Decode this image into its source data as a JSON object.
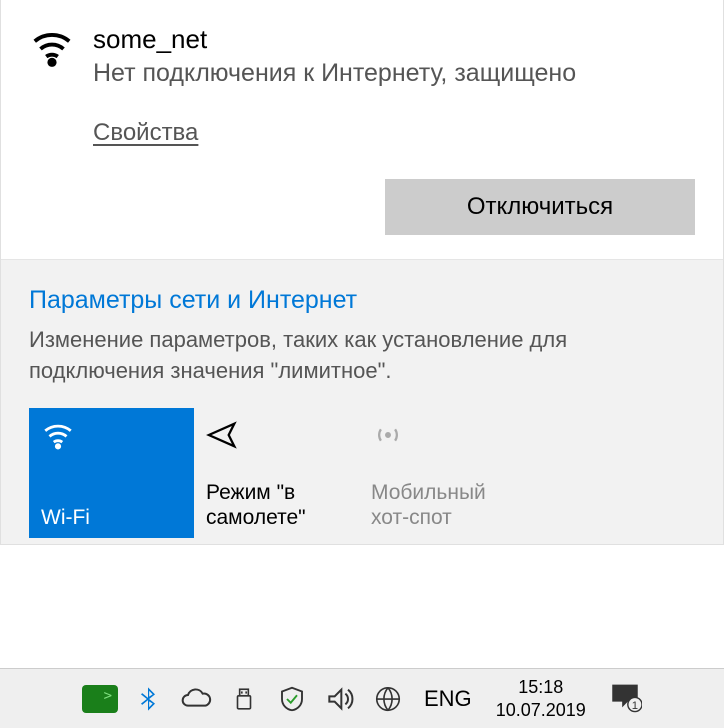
{
  "connection": {
    "ssid": "some_net",
    "status": "Нет подключения к Интернету, защищено",
    "properties_link": "Свойства",
    "disconnect_label": "Отключиться"
  },
  "settings": {
    "title": "Параметры сети и Интернет",
    "description": "Изменение параметров, таких как установление для подключения значения \"лимитное\"."
  },
  "tiles": {
    "wifi": "Wi-Fi",
    "airplane": "Режим \"в самолете\"",
    "hotspot": "Мобильный хот-спот"
  },
  "taskbar": {
    "language": "ENG",
    "time": "15:18",
    "date": "10.07.2019",
    "notification_count": "1"
  }
}
